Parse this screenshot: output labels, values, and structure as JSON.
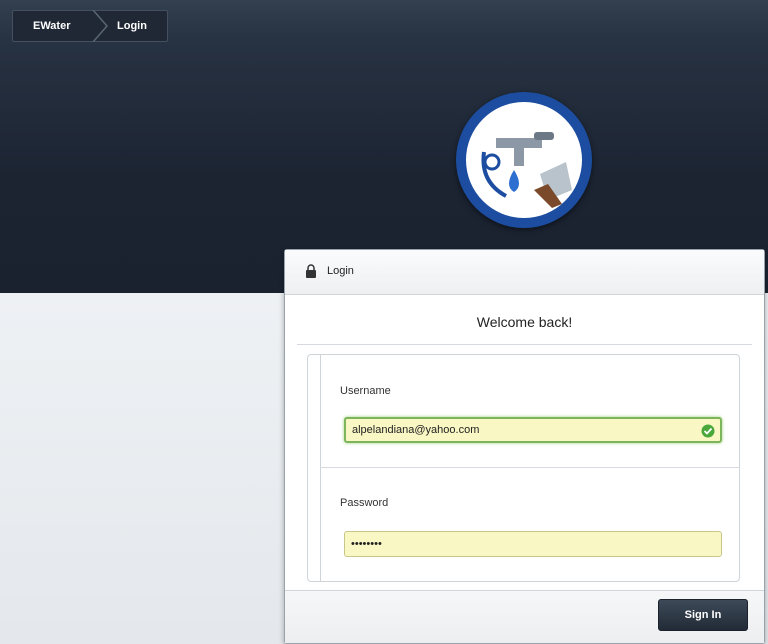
{
  "breadcrumb": {
    "home": "EWater",
    "current": "Login"
  },
  "logo": {
    "icon": "faucet-logo-icon"
  },
  "panel": {
    "title": "Login",
    "lock_icon": "lock-icon",
    "welcome": "Welcome back!",
    "username_label": "Username",
    "username_value": "alpelandiana@yahoo.com",
    "username_valid_icon": "check-circle-icon",
    "password_label": "Password",
    "password_value": "••••••••",
    "signin_label": "Sign In"
  },
  "colors": {
    "accent": "#7cb55c",
    "field_bg": "#f9f7c4",
    "topbar": "#1c2432"
  }
}
